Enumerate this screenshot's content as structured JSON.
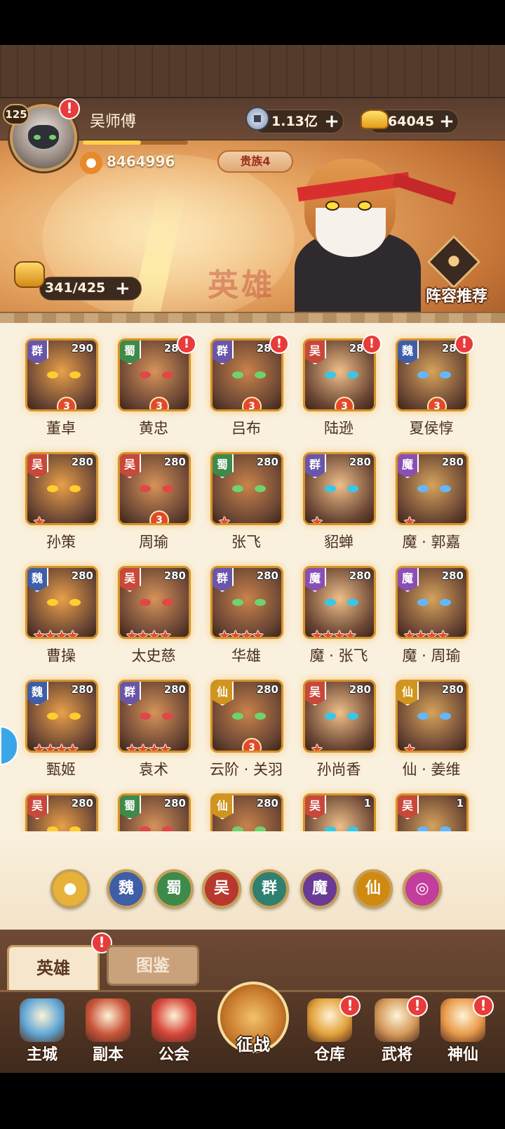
{
  "player": {
    "name": "吴师傅",
    "level": "125",
    "power": "8464996",
    "noble": "贵族4",
    "xp_fraction": 0.55
  },
  "resources": {
    "coins": "1.13亿",
    "gold": "64045",
    "plus": "+"
  },
  "roster": {
    "capacity": "341/425",
    "recommend_label": "阵容推荐",
    "watermark": "英雄"
  },
  "heroes": [
    {
      "name": "董卓",
      "faction": "群",
      "level": "290",
      "stars": 3,
      "alert": false
    },
    {
      "name": "黄忠",
      "faction": "蜀",
      "level": "281",
      "stars": 3,
      "alert": true
    },
    {
      "name": "吕布",
      "faction": "群",
      "level": "282",
      "stars": 3,
      "alert": true
    },
    {
      "name": "陆逊",
      "faction": "吴",
      "level": "281",
      "stars": 3,
      "alert": true
    },
    {
      "name": "夏侯惇",
      "faction": "魏",
      "level": "280",
      "stars": 3,
      "alert": true
    },
    {
      "name": "孙策",
      "faction": "吴",
      "level": "280",
      "stars": 1,
      "alert": false
    },
    {
      "name": "周瑜",
      "faction": "吴",
      "level": "280",
      "stars": 3,
      "alert": false
    },
    {
      "name": "张飞",
      "faction": "蜀",
      "level": "280",
      "stars": 1,
      "alert": false
    },
    {
      "name": "貂蝉",
      "faction": "群",
      "level": "280",
      "stars": 1,
      "alert": false
    },
    {
      "name": "魔 · 郭嘉",
      "faction": "魔",
      "level": "280",
      "stars": 1,
      "alert": false
    },
    {
      "name": "曹操",
      "faction": "魏",
      "level": "280",
      "stars": 4,
      "alert": false
    },
    {
      "name": "太史慈",
      "faction": "吴",
      "level": "280",
      "stars": 4,
      "alert": false
    },
    {
      "name": "华雄",
      "faction": "群",
      "level": "280",
      "stars": 4,
      "alert": false
    },
    {
      "name": "魔 · 张飞",
      "faction": "魔",
      "level": "280",
      "stars": 4,
      "alert": false
    },
    {
      "name": "魔 · 周瑜",
      "faction": "魔",
      "level": "280",
      "stars": 4,
      "alert": false
    },
    {
      "name": "甄姬",
      "faction": "魏",
      "level": "280",
      "stars": 4,
      "alert": false
    },
    {
      "name": "袁术",
      "faction": "群",
      "level": "280",
      "stars": 4,
      "alert": false
    },
    {
      "name": "云阶 · 关羽",
      "faction": "仙",
      "level": "280",
      "stars": 3,
      "alert": false
    },
    {
      "name": "孙尚香",
      "faction": "吴",
      "level": "280",
      "stars": 1,
      "alert": false
    },
    {
      "name": "仙 · 姜维",
      "faction": "仙",
      "level": "280",
      "stars": 1,
      "alert": false
    },
    {
      "name": "",
      "faction": "吴",
      "level": "280",
      "stars": 0,
      "alert": false
    },
    {
      "name": "",
      "faction": "蜀",
      "level": "280",
      "stars": 0,
      "alert": false
    },
    {
      "name": "",
      "faction": "仙",
      "level": "280",
      "stars": 0,
      "alert": false
    },
    {
      "name": "",
      "faction": "吴",
      "level": "1",
      "stars": 0,
      "alert": false
    },
    {
      "name": "",
      "faction": "吴",
      "level": "1",
      "stars": 0,
      "alert": false
    }
  ],
  "filters": [
    {
      "label": "",
      "icon": "paw-icon",
      "color": "#e8b23a"
    },
    {
      "label": "魏",
      "color": "#3f5ea8"
    },
    {
      "label": "蜀",
      "color": "#3e8a4a"
    },
    {
      "label": "吴",
      "color": "#b8382e"
    },
    {
      "label": "群",
      "color": "#2f8070"
    },
    {
      "label": "魔",
      "color": "#6a3b96"
    },
    {
      "label": "仙",
      "color": "#d08a12"
    },
    {
      "label": "",
      "icon": "swirl-icon",
      "color": "#c23e9c"
    }
  ],
  "faction_colors": {
    "群": "#6a56a8",
    "蜀": "#3e8a4a",
    "吴": "#c8483a",
    "魏": "#3f5ea8",
    "魔": "#8a4fb4",
    "仙": "#d0951e"
  },
  "tabs": {
    "hero": "英雄",
    "codex": "图鉴",
    "alert": "!"
  },
  "nav": [
    {
      "label": "主城",
      "alert": false
    },
    {
      "label": "副本",
      "alert": false
    },
    {
      "label": "公会",
      "alert": false
    },
    {
      "label": "征战",
      "alert": false
    },
    {
      "label": "仓库",
      "alert": true
    },
    {
      "label": "武将",
      "alert": true
    },
    {
      "label": "神仙",
      "alert": true
    }
  ]
}
